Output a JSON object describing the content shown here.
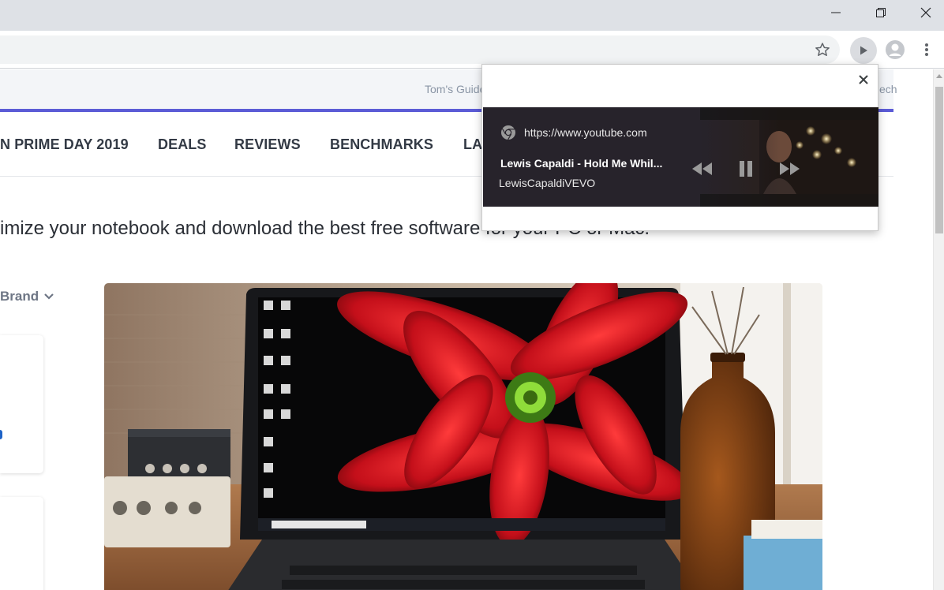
{
  "window": {
    "minimize_icon": "minimize-icon",
    "restore_icon": "restore-icon",
    "close_icon": "close-icon"
  },
  "toolbar": {
    "bookmark_icon": "star-outline-icon",
    "media_icon": "play-icon",
    "profile_icon": "account-icon",
    "menu_icon": "kebab-menu-icon"
  },
  "page": {
    "top_links": [
      "Tom's Guide",
      "ech"
    ],
    "nav": [
      "N PRIME DAY 2019",
      "DEALS",
      "REVIEWS",
      "BENCHMARKS",
      "LA"
    ],
    "intro_text": "imize your notebook and download the best free software for your PC or Mac.",
    "brand_filter": "Brand",
    "accent_color": "#5b5bd6"
  },
  "media_popup": {
    "origin_url": "https://www.youtube.com",
    "track_title": "Lewis Capaldi - Hold Me Whil...",
    "artist": "LewisCapaldiVEVO",
    "controls": [
      "previous-track-icon",
      "pause-icon",
      "next-track-icon"
    ],
    "close_icon": "close-icon"
  }
}
